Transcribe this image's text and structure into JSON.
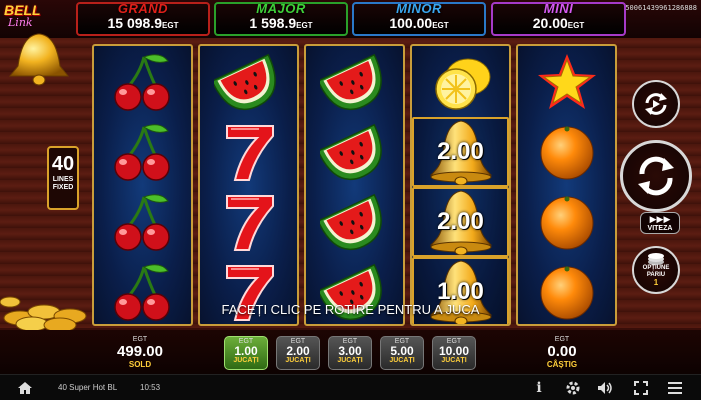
{
  "game": {
    "logo_line1": "BELL",
    "logo_line2": "Link"
  },
  "build_id": "50061439961286888",
  "jackpots": [
    {
      "name": "GRAND",
      "value": "15 098.9",
      "currency": "EGT",
      "color": "#e0201a",
      "border": "#b8201a"
    },
    {
      "name": "MAJOR",
      "value": "1 598.9",
      "currency": "EGT",
      "color": "#3fd13a",
      "border": "#2aa02a"
    },
    {
      "name": "MINOR",
      "value": "100.00",
      "currency": "EGT",
      "color": "#3aa7f0",
      "border": "#2a78c8"
    },
    {
      "name": "MINI",
      "value": "20.00",
      "currency": "EGT",
      "color": "#d55af0",
      "border": "#a63ac8"
    }
  ],
  "lines_badge": {
    "count": "40",
    "line1": "LINES",
    "line2": "FIXED"
  },
  "reels": [
    [
      "cherry",
      "cherry",
      "cherry",
      "cherry"
    ],
    [
      "watermelon",
      "seven",
      "seven",
      "seven"
    ],
    [
      "watermelon",
      "watermelon",
      "watermelon",
      "watermelon"
    ],
    [
      "lemon",
      "bell",
      "bell",
      "bell"
    ],
    [
      "star",
      "orange",
      "orange",
      "orange"
    ]
  ],
  "bell_values": [
    "2.00",
    "2.00",
    "1.00"
  ],
  "controls": {
    "autoplay_icon": "autoplay-icon",
    "spin_icon": "spin-icon",
    "speed_label": "VITEZA",
    "bet_options_label1": "OPȚIUNE",
    "bet_options_label2": "PARIU",
    "bet_options_value": "1"
  },
  "message": "FACEȚI CLIC PE ROTIRE PENTRU A JUCA",
  "balance": {
    "currency": "EGT",
    "value": "499.00",
    "label": "SOLD"
  },
  "win": {
    "currency": "EGT",
    "value": "0.00",
    "label": "CÂȘTIG"
  },
  "bets": [
    {
      "currency": "EGT",
      "value": "1.00",
      "label": "JUCAȚI",
      "selected": true
    },
    {
      "currency": "EGT",
      "value": "2.00",
      "label": "JUCAȚI",
      "selected": false
    },
    {
      "currency": "EGT",
      "value": "3.00",
      "label": "JUCAȚI",
      "selected": false
    },
    {
      "currency": "EGT",
      "value": "5.00",
      "label": "JUCAȚI",
      "selected": false
    },
    {
      "currency": "EGT",
      "value": "10.00",
      "label": "JUCAȚI",
      "selected": false
    }
  ],
  "sysbar": {
    "game_name": "40 Super Hot BL",
    "time": "10:53",
    "icons": [
      "home-icon",
      "info-icon",
      "settings-icon",
      "sound-icon",
      "fullscreen-icon",
      "menu-icon"
    ]
  }
}
